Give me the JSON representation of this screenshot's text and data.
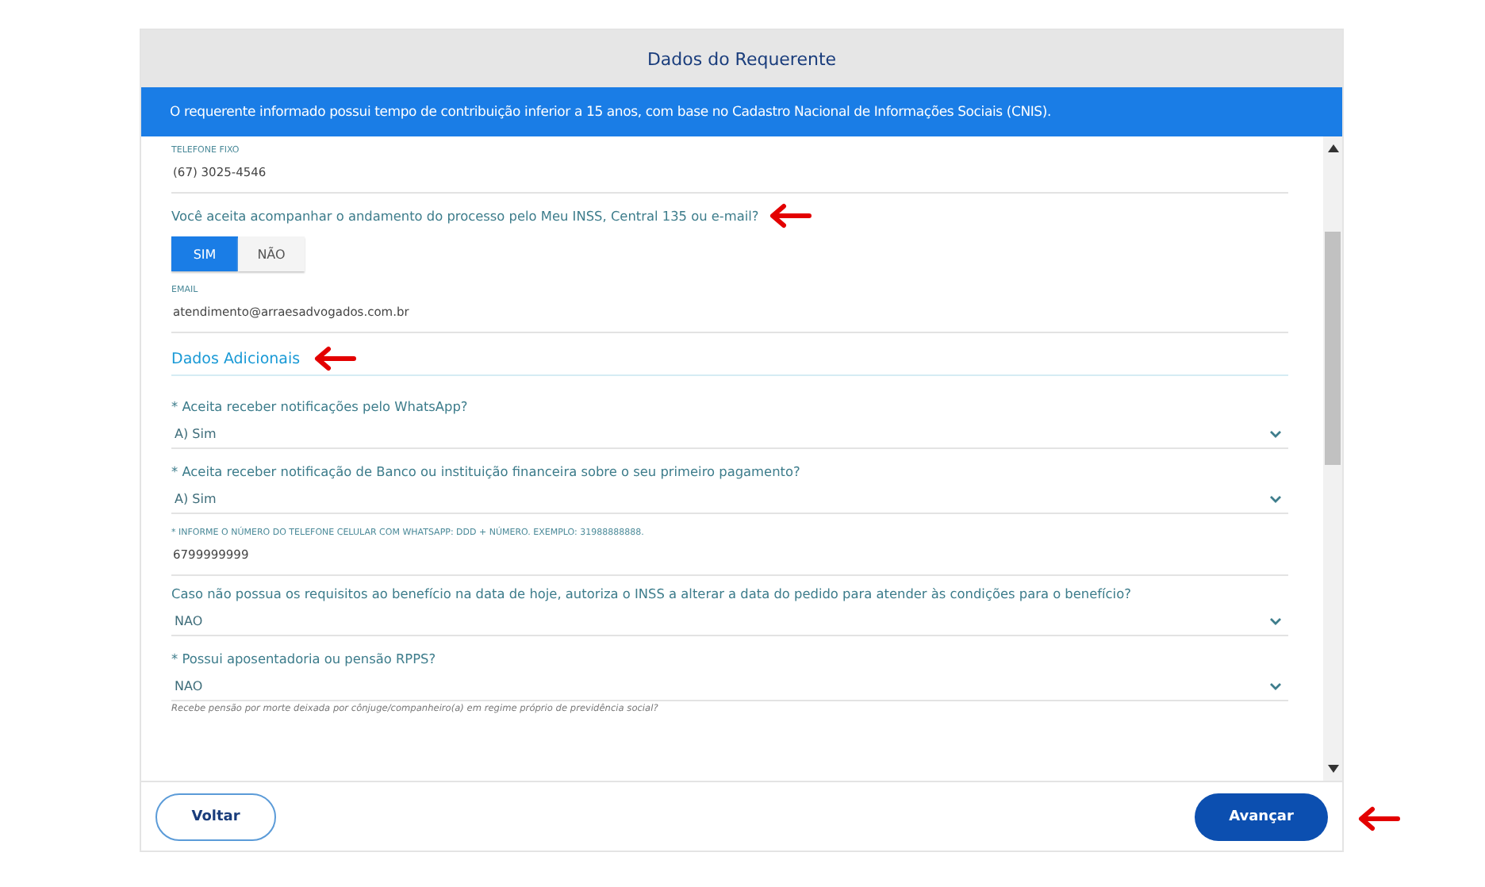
{
  "header": {
    "title": "Dados do Requerente"
  },
  "banner": {
    "text": "O requerente informado possui tempo de contribuição inferior a 15 anos, com base no Cadastro Nacional de Informações Sociais (CNIS)."
  },
  "fields": [
    {
      "kind": "text",
      "label": "TELEFONE FIXO",
      "value": "(67) 3025-4546"
    },
    {
      "kind": "toggle",
      "question": "Você aceita acompanhar o andamento do processo pelo Meu INSS, Central 135 ou e-mail?",
      "annotated": true,
      "options": [
        {
          "label": "SIM",
          "selected": true
        },
        {
          "label": "NÃO",
          "selected": false
        }
      ]
    },
    {
      "kind": "text",
      "label": "EMAIL",
      "value": "atendimento@arraesadvogados.com.br"
    },
    {
      "kind": "section",
      "title": "Dados Adicionais",
      "annotated": true
    },
    {
      "kind": "select",
      "question": "* Aceita receber notificações pelo WhatsApp?",
      "value": "A) Sim"
    },
    {
      "kind": "select",
      "question": "* Aceita receber notificação de Banco ou instituição financeira sobre o seu primeiro pagamento?",
      "value": "A) Sim"
    },
    {
      "kind": "text",
      "label": "* INFORME O NÚMERO DO TELEFONE CELULAR COM WHATSAPP: DDD + NÚMERO. EXEMPLO: 31988888888.",
      "value": "6799999999"
    },
    {
      "kind": "select",
      "question": "Caso não possua os requisitos ao benefício na data de hoje, autoriza o INSS a alterar a data do pedido para atender às condições para o benefício?",
      "value": "NAO"
    },
    {
      "kind": "select",
      "question": "* Possui aposentadoria ou pensão RPPS?",
      "value": "NAO",
      "help": "Recebe pensão por morte deixada por cônjuge/companheiro(a) em regime próprio de previdência social?"
    }
  ],
  "footer": {
    "back": "Voltar",
    "next": "Avançar",
    "next_annotated": true
  }
}
